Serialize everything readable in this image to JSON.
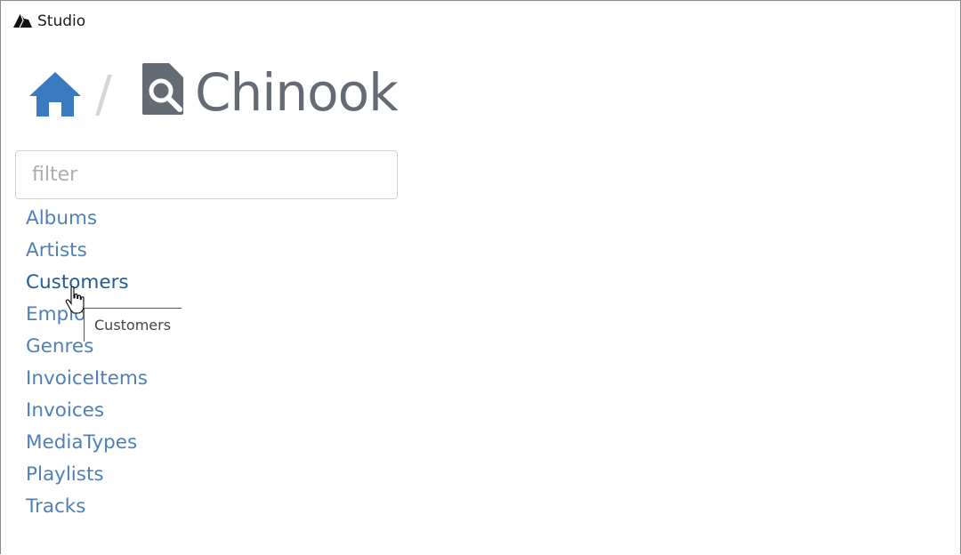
{
  "window": {
    "title": "Studio",
    "app_icon": "shark-fin-icon"
  },
  "breadcrumb": {
    "home_icon": "home-icon",
    "separator": "/",
    "database_icon": "database-search-icon",
    "database_name": "Chinook"
  },
  "filter": {
    "placeholder": "filter",
    "value": ""
  },
  "tables": [
    {
      "label": "Albums"
    },
    {
      "label": "Artists"
    },
    {
      "label": "Customers"
    },
    {
      "label": "Employees"
    },
    {
      "label": "Genres"
    },
    {
      "label": "InvoiceItems"
    },
    {
      "label": "Invoices"
    },
    {
      "label": "MediaTypes"
    },
    {
      "label": "Playlists"
    },
    {
      "label": "Tracks"
    }
  ],
  "hovered_table_index": 2,
  "tooltip": {
    "text": "Customers"
  },
  "colors": {
    "link": "#4d81b7",
    "link_hover": "#1f5a99",
    "home_icon": "#3a7bbf",
    "title_gray": "#646b74",
    "separator": "#d6d6d6"
  }
}
